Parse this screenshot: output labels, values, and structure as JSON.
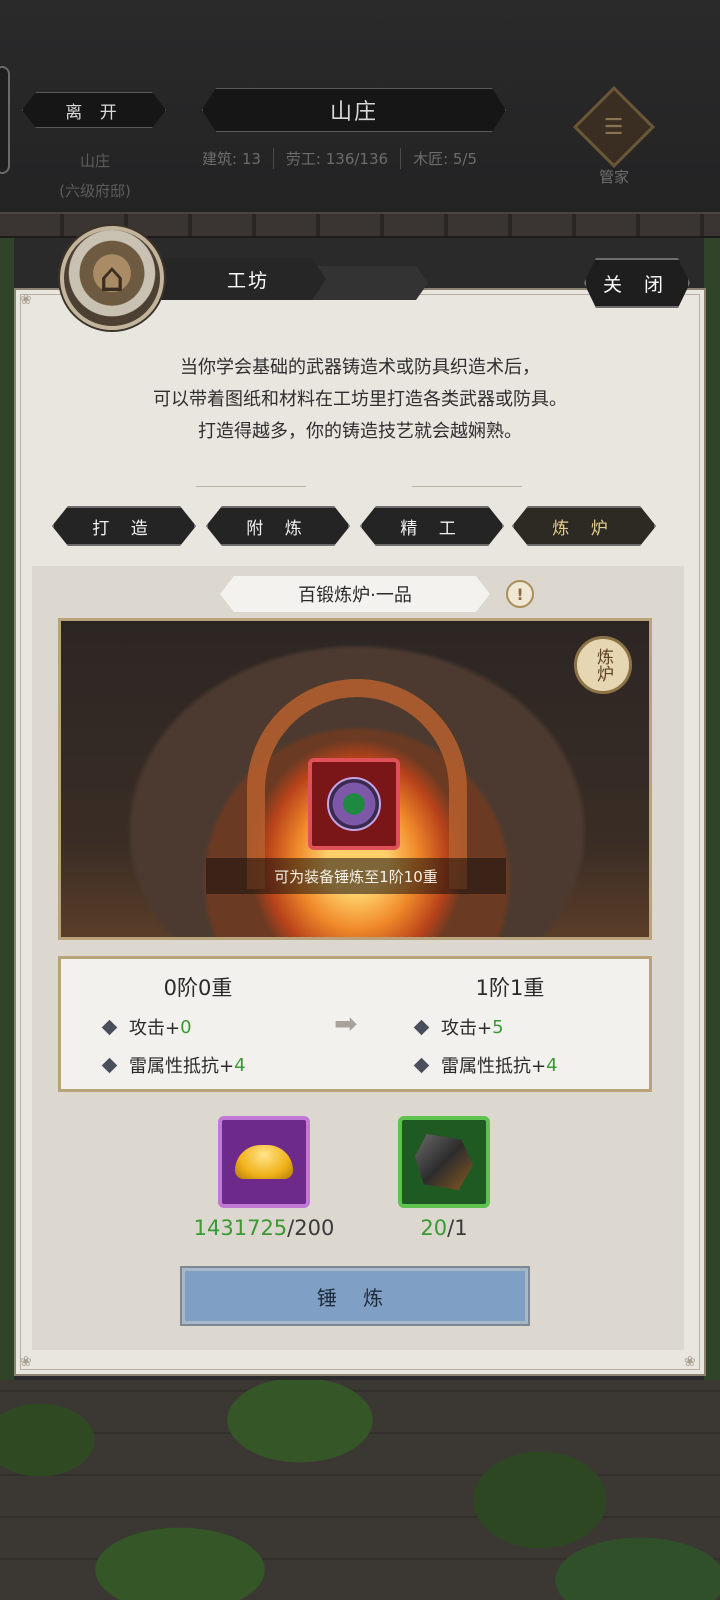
{
  "header": {
    "leave_label": "离 开",
    "title": "山庄",
    "sub1": "山庄",
    "sub2": "(六级府邸)",
    "stats": [
      "建筑: 13",
      "劳工: 136/136",
      "木匠: 5/5"
    ],
    "butler_label": "管家"
  },
  "panel": {
    "tab_workshop": "工坊",
    "tab_back": "",
    "close_label": "关 闭",
    "description": [
      "当你学会基础的武器铸造术或防具织造术后，",
      "可以带着图纸和材料在工坊里打造各类武器或防具。",
      "打造得越多，你的铸造技艺就会越娴熟。"
    ]
  },
  "func_tabs": [
    {
      "label": "打 造",
      "active": false
    },
    {
      "label": "附 炼",
      "active": false
    },
    {
      "label": "精 工",
      "active": false
    },
    {
      "label": "炼 炉",
      "active": true
    }
  ],
  "furnace": {
    "title": "百锻炼炉·一品",
    "info_icon": "!",
    "badge": "炼炉",
    "caption": "可为装备锤炼至1阶10重"
  },
  "upgrade": {
    "from_level": "0阶0重",
    "to_level": "1阶1重",
    "from_stats": [
      {
        "name": "攻击+",
        "value": "0"
      },
      {
        "name": "雷属性抵抗+",
        "value": "4"
      }
    ],
    "to_stats": [
      {
        "name": "攻击+",
        "value": "5"
      },
      {
        "name": "雷属性抵抗+",
        "value": "4"
      }
    ],
    "arrow": "➡"
  },
  "materials": [
    {
      "icon": "gold-ingot-icon",
      "have": "1431725",
      "need": "/200"
    },
    {
      "icon": "ore-icon",
      "have": "20",
      "need": "/1"
    }
  ],
  "action": {
    "label": "锤 炼"
  },
  "colors": {
    "accent_green": "#3a9a32",
    "button_blue": "#7f9fc4",
    "active_tab_text": "#e7cf8c"
  }
}
